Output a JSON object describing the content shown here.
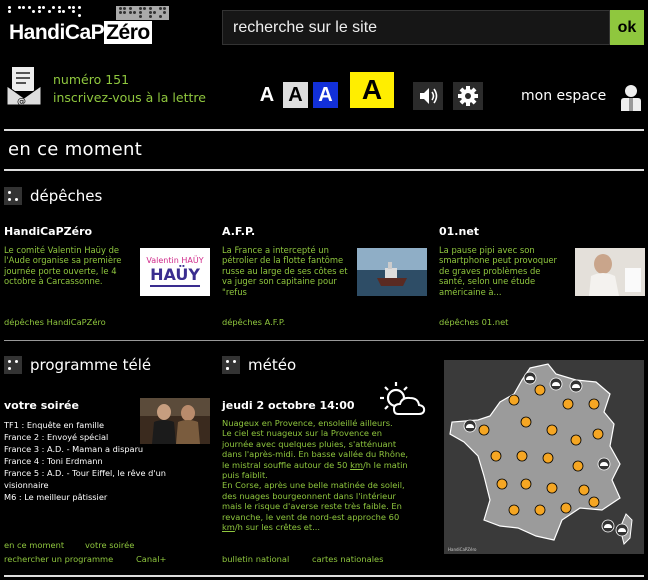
{
  "header": {
    "logo_text_left": "HandiCaP",
    "logo_text_right": "Zéro",
    "search_placeholder": "recherche sur le site",
    "search_button": "ok",
    "newsletter_number": "numéro 151",
    "newsletter_subscribe": "inscrivez-vous à la lettre",
    "font_sizes": [
      "A",
      "A",
      "A",
      "A"
    ],
    "my_space": "mon espace"
  },
  "colors": {
    "accent_green": "#8fc73e",
    "highlight_yellow": "#ffee00",
    "contrast_blue": "#1230d8"
  },
  "section": {
    "title": "en ce moment"
  },
  "depeches": {
    "title": "dépêches",
    "items": [
      {
        "source": "HandiCaPZéro",
        "text": "Le comité Valentin Haüy de l'Aude organise sa première journée porte ouverte, le 4 octobre à Carcassonne.",
        "link": "dépêches HandiCaPZéro",
        "image_caption": "Valentin HAÜY"
      },
      {
        "source": "A.F.P.",
        "text": "La France a intercepté un pétrolier de la flotte fantôme russe au large de ses côtes et va juger son capitaine pour \"refus",
        "link": "dépêches A.F.P."
      },
      {
        "source": "01.net",
        "text": "La pause pipi avec son smartphone peut provoquer de graves problèmes de santé, selon une étude américaine à...",
        "link": "dépêches 01.net"
      }
    ]
  },
  "tv": {
    "title": "programme télé",
    "subtitle": "votre soirée",
    "items": [
      "TF1 : Enquête en famille",
      "France 2 : Envoyé spécial",
      "France 3 : A.D. - Maman a disparu",
      "France 4 : Toni Erdmann",
      "France 5 : A.D. - Tour Eiffel, le rêve d'un visionnaire",
      "M6 : Le meilleur pâtissier"
    ],
    "links": [
      "en ce moment",
      "votre soirée",
      "rechercher un programme",
      "Canal+"
    ]
  },
  "meteo": {
    "title": "météo",
    "date": "jeudi 2 octobre 14:00",
    "text_lines": [
      "Nuageux en Provence, ensoleillé ailleurs.",
      "Le ciel est nuageux sur la Provence en journée avec quelques pluies, s'atténuant dans l'après-midi. En basse vallée du Rhône, le mistral souffle autour de 50 ",
      "km",
      "/h le matin puis faiblit.",
      "En Corse, après une belle matinée de soleil, des nuages bourgeonnent dans l'intérieur mais le risque d'averse reste très faible. En revanche, le vent de nord-est approche 60 ",
      "km",
      "/h sur les crêtes et..."
    ],
    "links": [
      "bulletin national",
      "cartes nationales"
    ]
  }
}
